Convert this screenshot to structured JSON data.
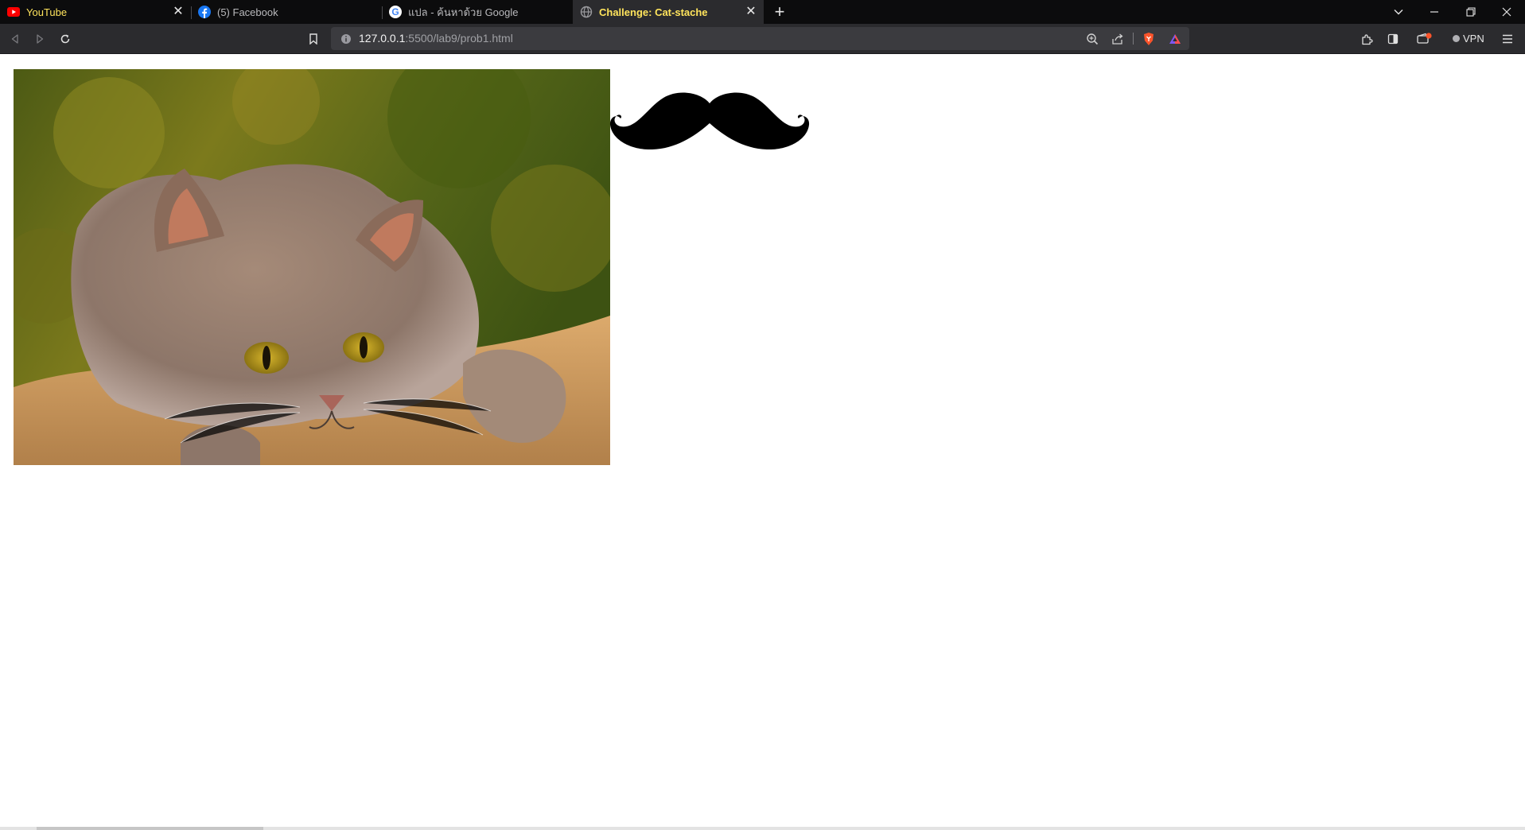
{
  "browser": {
    "tabs": [
      {
        "title": "YouTube",
        "icon": "youtube-icon"
      },
      {
        "title": "(5) Facebook",
        "icon": "facebook-icon"
      },
      {
        "title": "แปล - ค้นหาด้วย Google",
        "icon": "google-icon"
      },
      {
        "title": "Challenge: Cat-stache",
        "icon": "globe-icon",
        "active": true
      }
    ],
    "url": {
      "host": "127.0.0.1",
      "path": ":5500/lab9/prob1.html"
    },
    "vpn_label": "VPN"
  },
  "page": {
    "images": [
      {
        "name": "cat-photo",
        "alt": "cat photo"
      },
      {
        "name": "mustache",
        "alt": "mustache"
      }
    ]
  },
  "colors": {
    "tab_strip": "#0c0c0d",
    "toolbar": "#2b2b2e",
    "active_tab_text": "#ffe45c",
    "page_background": "#ffffff"
  }
}
